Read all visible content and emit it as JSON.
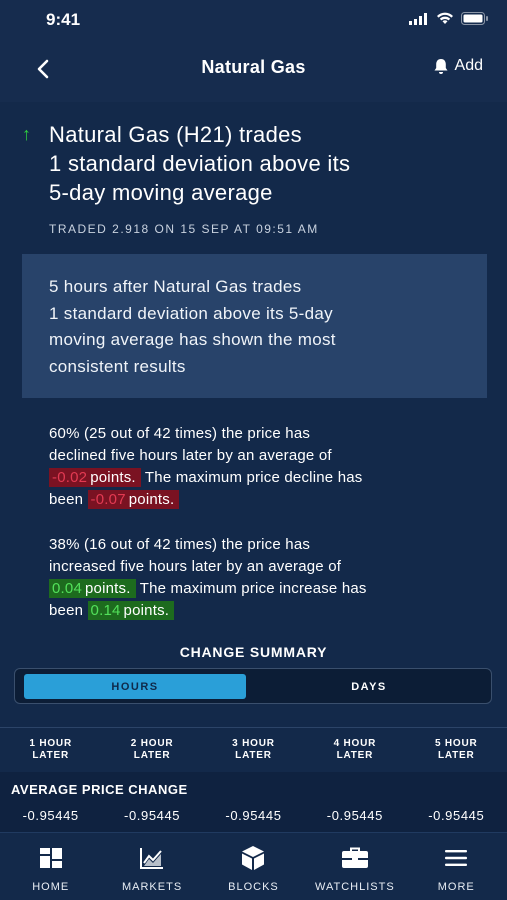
{
  "status": {
    "time": "9:41"
  },
  "nav": {
    "title": "Natural Gas",
    "add_label": "Add"
  },
  "headline": {
    "lines": [
      "Natural Gas (H21) trades",
      "1 standard deviation above its",
      "5-day moving average"
    ],
    "traded": "TRADED 2.918 ON 15 SEP AT 09:51 AM"
  },
  "result_box": {
    "lines": [
      "5 hours after Natural Gas trades",
      "1 standard deviation above its 5-day",
      "moving average has shown the most",
      "consistent results"
    ]
  },
  "decline": {
    "text1": "60% (25 out of 42 times) the price has",
    "text2": "declined five hours later by an average of",
    "avg_value": "-0.02",
    "unit1": "points.",
    "text3": "The maximum price decline has",
    "text4": "been",
    "max_value": "-0.07",
    "unit2": "points."
  },
  "increase": {
    "text1": "38% (16 out of 42 times) the price has",
    "text2": "increased five hours later by an average of",
    "avg_value": "0.04",
    "unit1": "points.",
    "text3": "The maximum price increase has",
    "text4": "been",
    "max_value": "0.14",
    "unit2": "points."
  },
  "summary": {
    "title": "CHANGE SUMMARY",
    "tab_hours": "HOURS",
    "tab_days": "DAYS",
    "selected": "HOURS",
    "columns": [
      {
        "top": "1 HOUR",
        "bottom": "LATER"
      },
      {
        "top": "2 HOUR",
        "bottom": "LATER"
      },
      {
        "top": "3 HOUR",
        "bottom": "LATER"
      },
      {
        "top": "4 HOUR",
        "bottom": "LATER"
      },
      {
        "top": "5 HOUR",
        "bottom": "LATER"
      }
    ],
    "avg_label": "AVERAGE PRICE CHANGE",
    "avg_values": [
      "-0.95445",
      "-0.95445",
      "-0.95445",
      "-0.95445",
      "-0.95445"
    ]
  },
  "tabbar": {
    "items": [
      {
        "label": "HOME",
        "icon": "home-grid-icon"
      },
      {
        "label": "MARKETS",
        "icon": "chart-icon"
      },
      {
        "label": "BLOCKS",
        "icon": "cube-icon"
      },
      {
        "label": "WATCHLISTS",
        "icon": "briefcase-icon"
      },
      {
        "label": "MORE",
        "icon": "hamburger-icon"
      }
    ]
  },
  "colors": {
    "background": "#13294a",
    "accent": "#2a9fd8",
    "negative": "#e23a52",
    "positive": "#52e05a",
    "up_arrow": "#2ecc40"
  }
}
